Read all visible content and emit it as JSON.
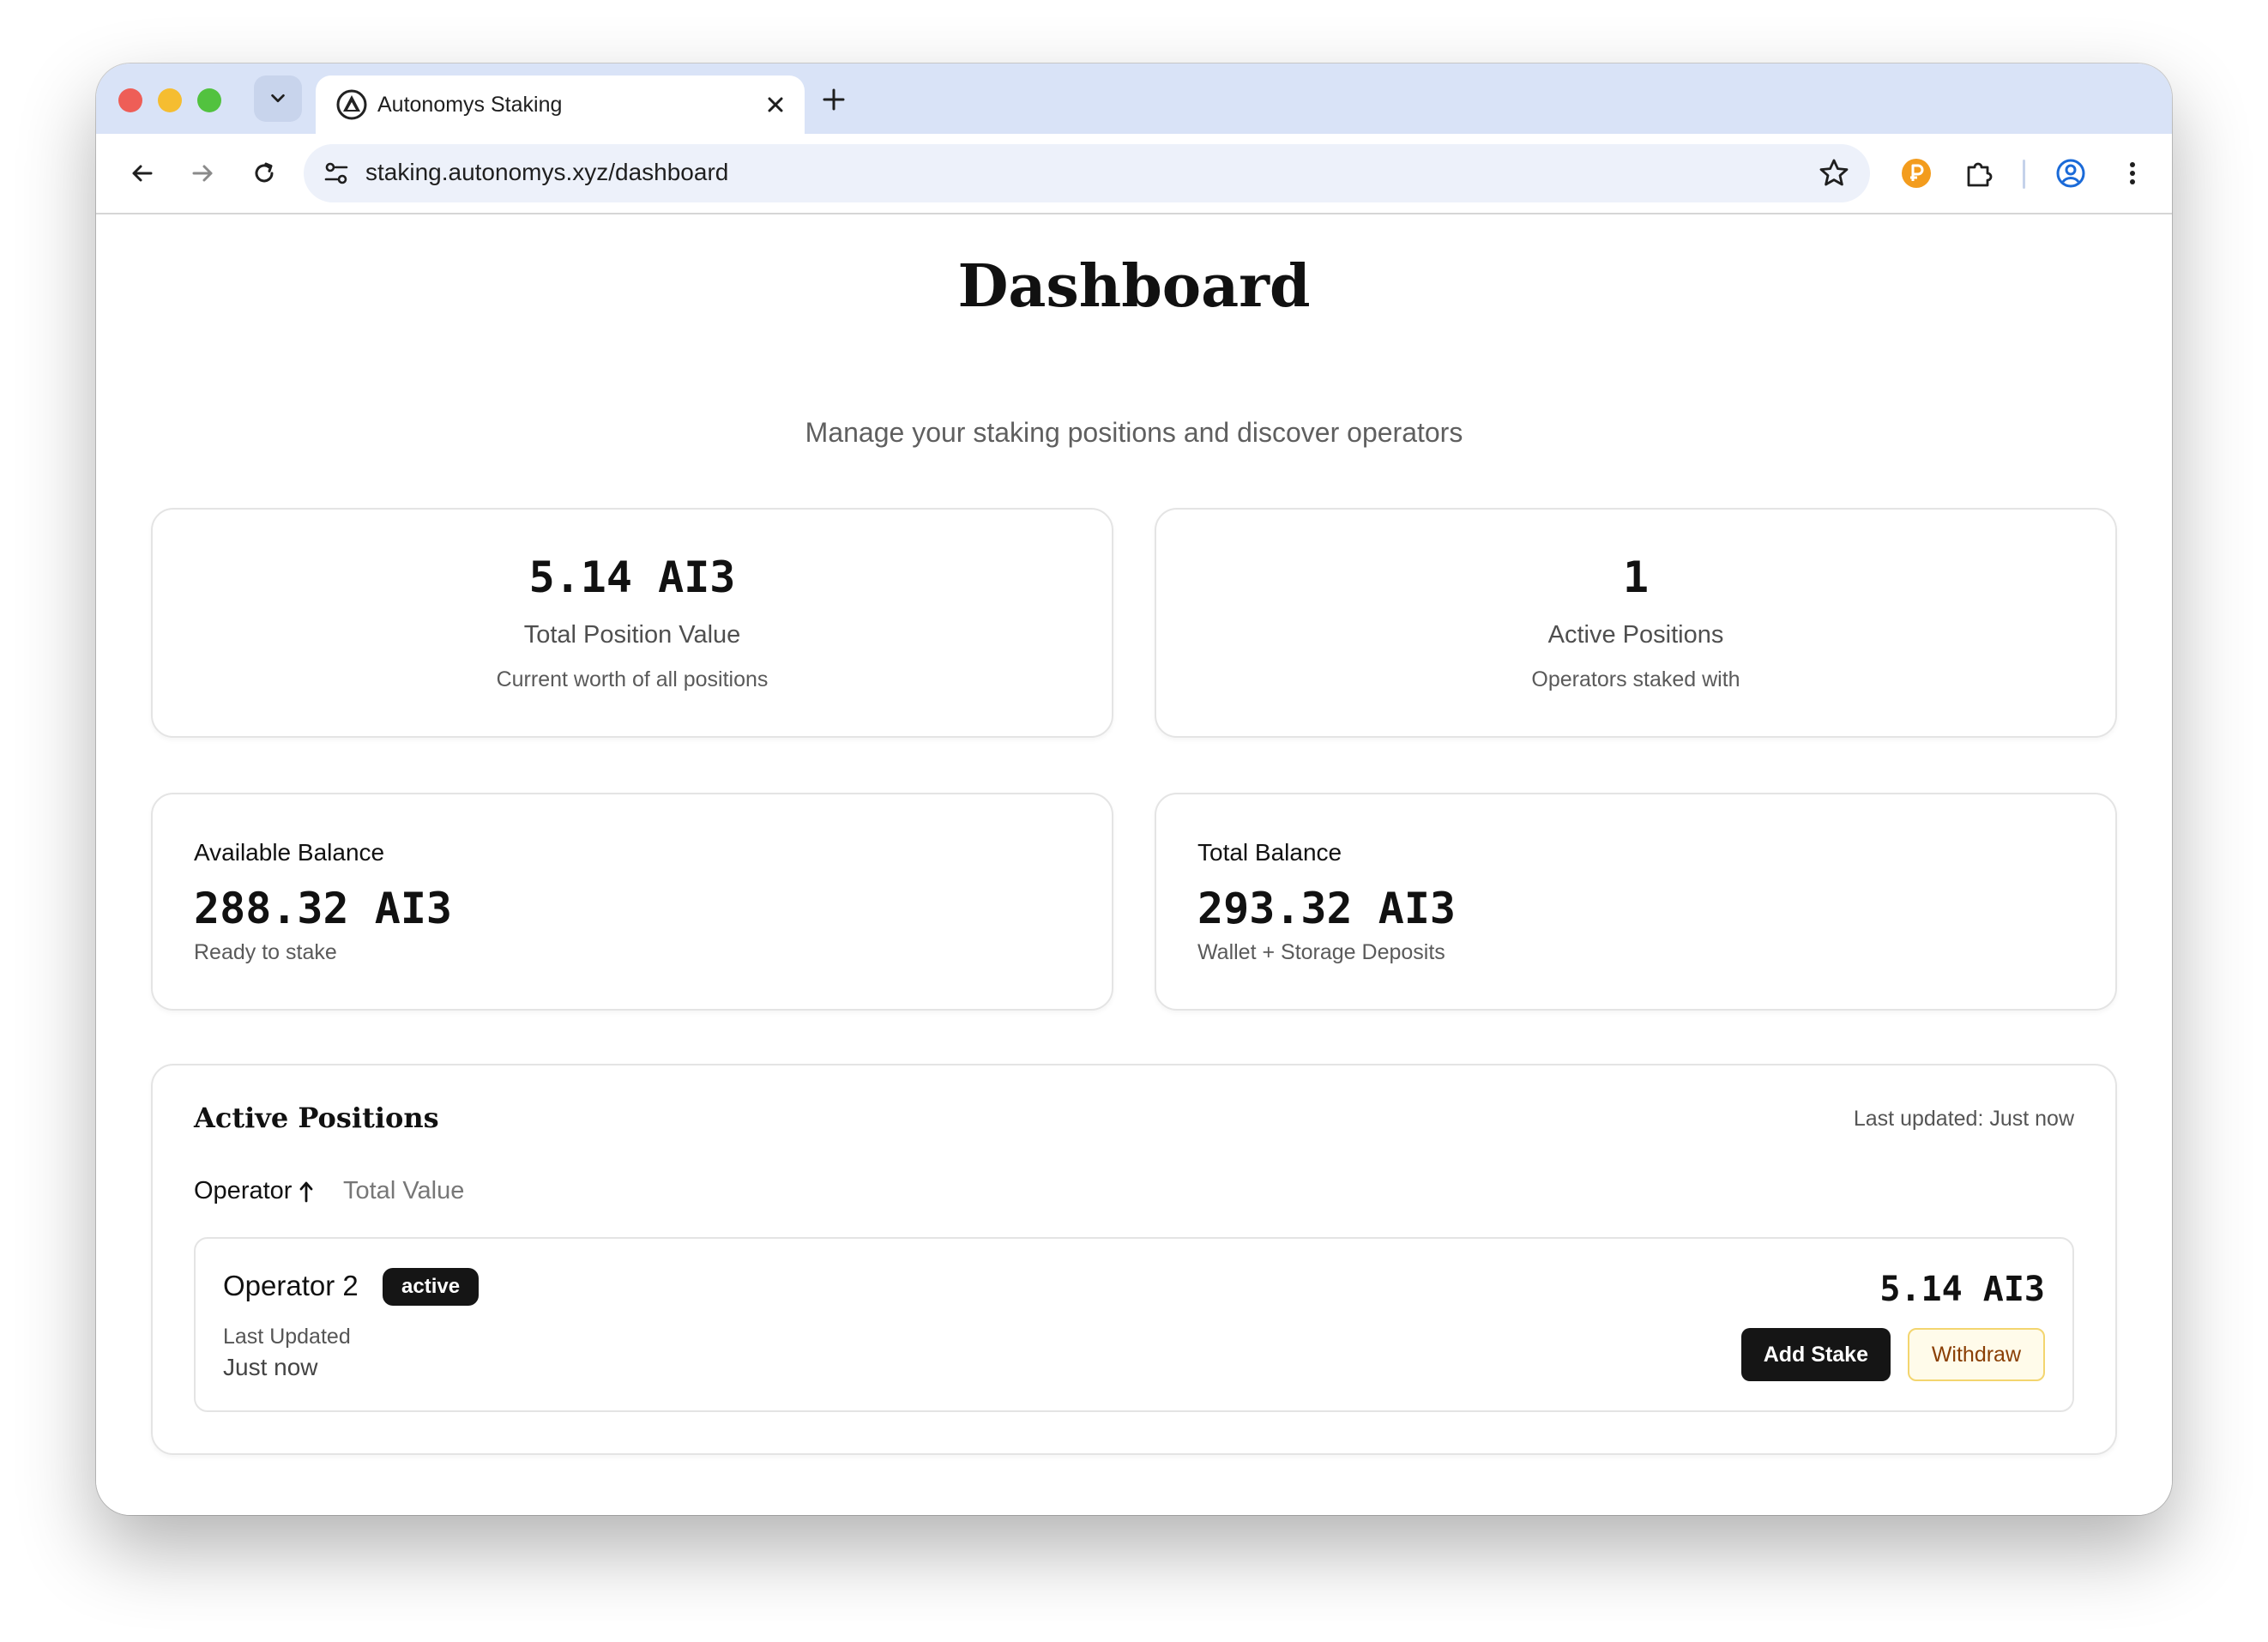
{
  "browser": {
    "tab_title": "Autonomys Staking",
    "url": "staking.autonomys.xyz/dashboard"
  },
  "page": {
    "title": "Dashboard",
    "subtitle": "Manage your staking positions and discover operators"
  },
  "stats": [
    {
      "value": "5.14 AI3",
      "label": "Total Position Value",
      "description": "Current worth of all positions"
    },
    {
      "value": "1",
      "label": "Active Positions",
      "description": "Operators staked with"
    }
  ],
  "balances": [
    {
      "label": "Available Balance",
      "value": "288.32 AI3",
      "description": "Ready to stake"
    },
    {
      "label": "Total Balance",
      "value": "293.32 AI3",
      "description": "Wallet + Storage Deposits"
    }
  ],
  "positions": {
    "heading": "Active Positions",
    "last_updated": "Last updated: Just now",
    "sort": {
      "operator_label": "Operator",
      "total_value_label": "Total Value"
    },
    "rows": [
      {
        "operator": "Operator 2",
        "status": "active",
        "updated_label": "Last Updated",
        "updated_value": "Just now",
        "value": "5.14 AI3",
        "add_label": "Add Stake",
        "withdraw_label": "Withdraw"
      }
    ]
  },
  "colors": {
    "tabbar": "#d9e3f7",
    "accent_dark": "#151515",
    "withdraw_bg": "#fffbea",
    "withdraw_border": "#f3d56f",
    "withdraw_text": "#8a3f05",
    "extension_orange": "#f39c1d",
    "profile_blue": "#1a6ad8"
  },
  "icons": {
    "tab_dropdown": "chevron-down-icon",
    "favicon": "autonomys-logo-icon",
    "close": "close-icon",
    "new_tab": "plus-icon",
    "back": "arrow-left-icon",
    "forward": "arrow-right-icon",
    "reload": "reload-icon",
    "site_info": "tune-icon",
    "bookmark": "star-icon",
    "wallet_extension": "p-extension-icon",
    "extensions": "puzzle-icon",
    "profile": "profile-icon",
    "menu": "kebab-menu-icon",
    "sort": "arrow-up-icon"
  }
}
